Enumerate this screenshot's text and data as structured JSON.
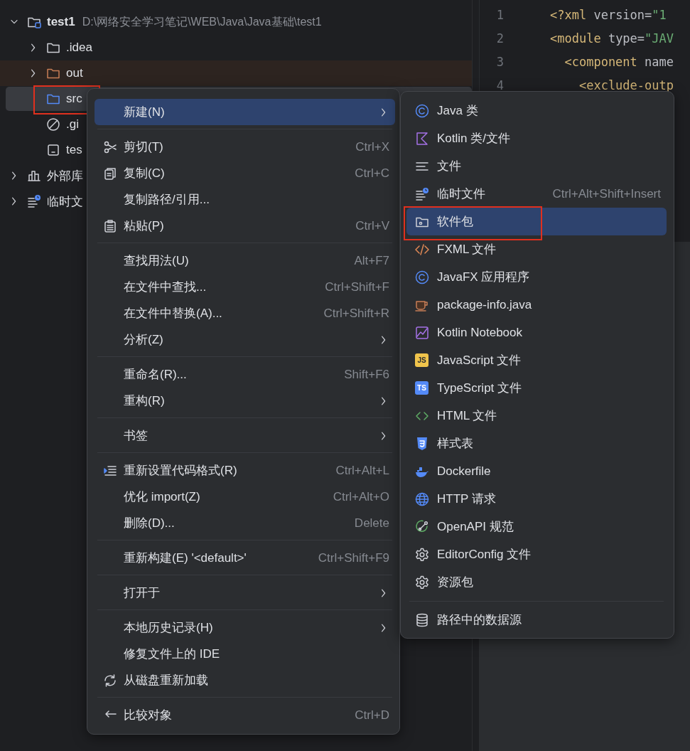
{
  "project_tree": [
    {
      "label": "test1",
      "path": "D:\\网络安全学习笔记\\WEB\\Java\\Java基础\\test1",
      "kind": "module",
      "expanded": true,
      "selected": false,
      "highlighted": false,
      "annotated": false,
      "children": [
        {
          "label": ".idea",
          "kind": "folder",
          "expanded": false,
          "selected": false,
          "highlighted": false,
          "annotated": false
        },
        {
          "label": "out",
          "kind": "folder-excluded",
          "expanded": false,
          "selected": false,
          "highlighted": true,
          "annotated": false
        },
        {
          "label": "src",
          "kind": "folder-source",
          "selected": true,
          "highlighted": false,
          "annotated": true
        },
        {
          "label": ".gi",
          "kind": "ignore",
          "selected": false,
          "highlighted": false,
          "annotated": false
        },
        {
          "label": "tes",
          "kind": "file",
          "selected": false,
          "highlighted": false,
          "annotated": false
        }
      ]
    },
    {
      "label": "外部库",
      "kind": "library",
      "expanded": false,
      "selected": false,
      "highlighted": false,
      "annotated": false
    },
    {
      "label": "临时文",
      "kind": "scratch",
      "expanded": false,
      "selected": false,
      "highlighted": false,
      "annotated": false
    }
  ],
  "editor": {
    "lines": [
      {
        "number": "1",
        "tokens": [
          {
            "text": "<?xml",
            "kind": "tag"
          },
          {
            "text": " version=",
            "kind": "attr"
          },
          {
            "text": "\"1",
            "kind": "string"
          }
        ]
      },
      {
        "number": "2",
        "tokens": [
          {
            "text": "<module",
            "kind": "tag"
          },
          {
            "text": " type=",
            "kind": "attr"
          },
          {
            "text": "\"JAV",
            "kind": "string"
          }
        ]
      },
      {
        "number": "3",
        "tokens": [
          {
            "text": "  <component",
            "kind": "tag"
          },
          {
            "text": " name",
            "kind": "attr"
          }
        ]
      },
      {
        "number": "4",
        "tokens": [
          {
            "text": "    <exclude-outp",
            "kind": "tag"
          }
        ]
      }
    ]
  },
  "context_menu": [
    {
      "kind": "plain",
      "label": "新建(N)",
      "submenu": true,
      "selected": true
    },
    {
      "kind": "separator"
    },
    {
      "kind": "cut",
      "label": "剪切(T)",
      "shortcut": "Ctrl+X",
      "selected": false
    },
    {
      "kind": "copy",
      "label": "复制(C)",
      "shortcut": "Ctrl+C",
      "selected": false
    },
    {
      "kind": "plain",
      "label": "复制路径/引用...",
      "selected": false
    },
    {
      "kind": "paste",
      "label": "粘贴(P)",
      "shortcut": "Ctrl+V",
      "selected": false
    },
    {
      "kind": "separator"
    },
    {
      "kind": "plain",
      "label": "查找用法(U)",
      "shortcut": "Alt+F7",
      "selected": false
    },
    {
      "kind": "plain",
      "label": "在文件中查找...",
      "shortcut": "Ctrl+Shift+F",
      "selected": false
    },
    {
      "kind": "plain",
      "label": "在文件中替换(A)...",
      "shortcut": "Ctrl+Shift+R",
      "selected": false
    },
    {
      "kind": "plain",
      "label": "分析(Z)",
      "submenu": true,
      "selected": false
    },
    {
      "kind": "separator"
    },
    {
      "kind": "plain",
      "label": "重命名(R)...",
      "shortcut": "Shift+F6",
      "selected": false
    },
    {
      "kind": "plain",
      "label": "重构(R)",
      "submenu": true,
      "selected": false
    },
    {
      "kind": "separator"
    },
    {
      "kind": "plain",
      "label": "书签",
      "submenu": true,
      "selected": false
    },
    {
      "kind": "separator"
    },
    {
      "kind": "reformat",
      "label": "重新设置代码格式(R)",
      "shortcut": "Ctrl+Alt+L",
      "selected": false
    },
    {
      "kind": "plain",
      "label": "优化 import(Z)",
      "shortcut": "Ctrl+Alt+O",
      "selected": false
    },
    {
      "kind": "plain",
      "label": "删除(D)...",
      "shortcut": "Delete",
      "selected": false
    },
    {
      "kind": "separator"
    },
    {
      "kind": "plain",
      "label": "重新构建(E) '<default>'",
      "shortcut": "Ctrl+Shift+F9",
      "selected": false
    },
    {
      "kind": "separator"
    },
    {
      "kind": "plain",
      "label": "打开于",
      "submenu": true,
      "selected": false
    },
    {
      "kind": "separator"
    },
    {
      "kind": "plain",
      "label": "本地历史记录(H)",
      "submenu": true,
      "selected": false
    },
    {
      "kind": "plain",
      "label": "修复文件上的 IDE",
      "selected": false
    },
    {
      "kind": "reload",
      "label": "从磁盘重新加载",
      "selected": false
    },
    {
      "kind": "separator"
    },
    {
      "kind": "compare",
      "label": "比较对象",
      "shortcut": "Ctrl+D",
      "selected": false
    }
  ],
  "new_submenu": [
    {
      "kind": "class",
      "label": "Java 类",
      "selected": false,
      "annotated": false
    },
    {
      "kind": "kotlin",
      "label": "Kotlin 类/文件",
      "selected": false,
      "annotated": false
    },
    {
      "kind": "text",
      "label": "文件",
      "selected": false,
      "annotated": false
    },
    {
      "kind": "scratch",
      "label": "临时文件",
      "shortcut": "Ctrl+Alt+Shift+Insert",
      "selected": false,
      "annotated": false
    },
    {
      "kind": "package",
      "label": "软件包",
      "selected": true,
      "annotated": true
    },
    {
      "kind": "fxml",
      "label": "FXML 文件",
      "selected": false,
      "annotated": false
    },
    {
      "kind": "class",
      "label": "JavaFX 应用程序",
      "selected": false,
      "annotated": false
    },
    {
      "kind": "cup",
      "label": "package-info.java",
      "selected": false,
      "annotated": false
    },
    {
      "kind": "notebook",
      "label": "Kotlin Notebook",
      "selected": false,
      "annotated": false
    },
    {
      "kind": "js",
      "label": "JavaScript 文件",
      "icon_text": "JS",
      "selected": false,
      "annotated": false
    },
    {
      "kind": "ts",
      "label": "TypeScript 文件",
      "icon_text": "TS",
      "selected": false,
      "annotated": false
    },
    {
      "kind": "html",
      "label": "HTML 文件",
      "selected": false,
      "annotated": false
    },
    {
      "kind": "css",
      "label": "样式表",
      "selected": false,
      "annotated": false
    },
    {
      "kind": "docker",
      "label": "Dockerfile",
      "selected": false,
      "annotated": false
    },
    {
      "kind": "globe",
      "label": "HTTP 请求",
      "selected": false,
      "annotated": false
    },
    {
      "kind": "openapi",
      "label": "OpenAPI 规范",
      "selected": false,
      "annotated": false
    },
    {
      "kind": "gear",
      "label": "EditorConfig 文件",
      "selected": false,
      "annotated": false
    },
    {
      "kind": "gear",
      "label": "资源包",
      "selected": false,
      "annotated": false
    },
    {
      "kind": "separator"
    },
    {
      "kind": "database",
      "label": "路径中的数据源",
      "selected": false,
      "annotated": false
    }
  ]
}
